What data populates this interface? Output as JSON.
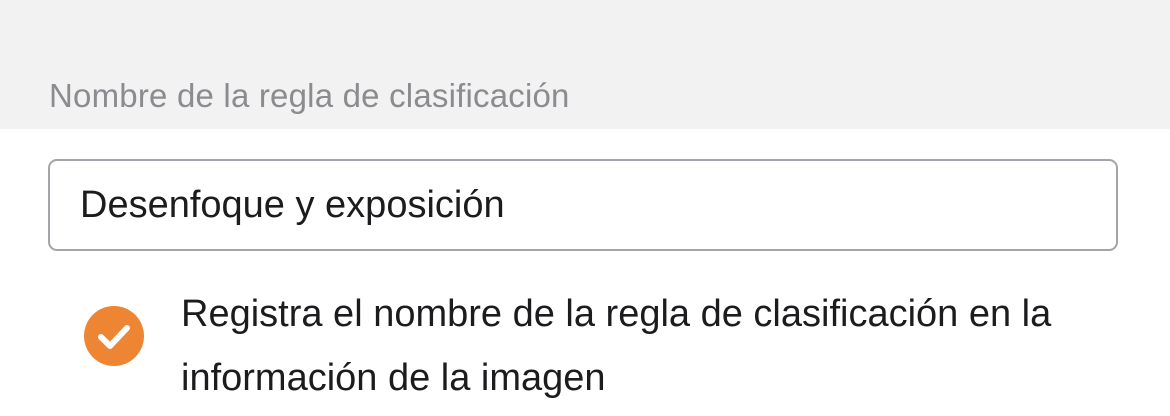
{
  "section": {
    "title": "Nombre de la regla de clasificación"
  },
  "name_field": {
    "value": "Desenfoque y exposición"
  },
  "record_option": {
    "checked": true,
    "label": "Registra el nombre de la regla de clasificación en la información de la imagen"
  },
  "colors": {
    "accent": "#ee8533",
    "header_background": "#f2f2f2",
    "section_title": "#8b8b90",
    "field_border": "#a4a4ac",
    "text": "#1c1c1e"
  },
  "icons": {
    "checkbox": "checkmark-circle-icon"
  }
}
